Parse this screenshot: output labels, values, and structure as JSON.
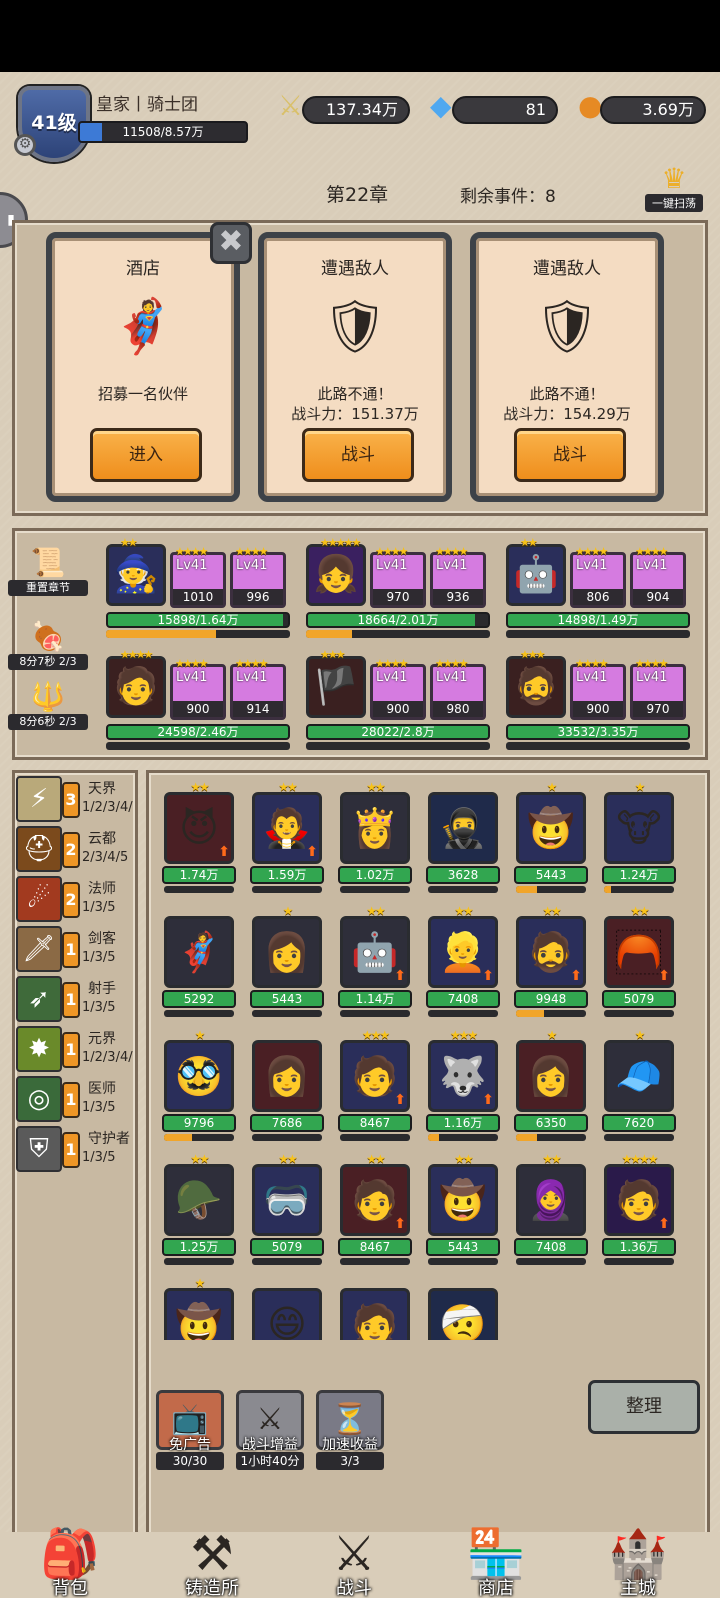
{
  "header": {
    "level": "41级",
    "player_name": "皇家丨骑士团",
    "exp_text": "11508/8.57万",
    "exp_fraction": 0.134,
    "combat_power": "137.34万",
    "gems": "81",
    "gold": "3.69万",
    "chapter": "第22章",
    "remaining_events": "剩余事件：8",
    "sweep_label": "一键扫荡"
  },
  "events": [
    {
      "title": "酒店",
      "icon": "hero-recruit-icon",
      "desc": "招募一名伙伴",
      "button": "进入"
    },
    {
      "title": "遭遇敌人",
      "icon": "armored-knight-icon",
      "desc": "此路不通！\n战斗力：151.37万",
      "button": "战斗"
    },
    {
      "title": "遭遇敌人",
      "icon": "armored-knight-icon",
      "desc": "此路不通！\n战斗力：154.29万",
      "button": "战斗"
    }
  ],
  "sidebar_tools": [
    {
      "label": "重置章节",
      "icon": "scroll-icon"
    },
    {
      "label": "8分7秒 2/3",
      "icon": "meat-icon"
    },
    {
      "label": "8分6秒 2/3",
      "icon": "staff-icon"
    }
  ],
  "team": [
    {
      "stars": 2,
      "equip": [
        {
          "lv": "Lv41",
          "count": "1010"
        },
        {
          "lv": "Lv41",
          "count": "996"
        }
      ],
      "hp": "15898/1.64万",
      "hp_fraction": 0.97,
      "sub_fraction": 0.6
    },
    {
      "stars": 5,
      "equip": [
        {
          "lv": "Lv41",
          "count": "970"
        },
        {
          "lv": "Lv41",
          "count": "936"
        }
      ],
      "hp": "18664/2.01万",
      "hp_fraction": 0.93,
      "sub_fraction": 0.25
    },
    {
      "stars": 2,
      "equip": [
        {
          "lv": "Lv41",
          "count": "806"
        },
        {
          "lv": "Lv41",
          "count": "904"
        }
      ],
      "hp": "14898/1.49万",
      "hp_fraction": 1.0,
      "sub_fraction": 0.0
    },
    {
      "stars": 4,
      "equip": [
        {
          "lv": "Lv41",
          "count": "900"
        },
        {
          "lv": "Lv41",
          "count": "914"
        }
      ],
      "hp": "24598/2.46万",
      "hp_fraction": 1.0,
      "sub_fraction": 0.0
    },
    {
      "stars": 3,
      "equip": [
        {
          "lv": "Lv41",
          "count": "900"
        },
        {
          "lv": "Lv41",
          "count": "980"
        }
      ],
      "hp": "28022/2.8万",
      "hp_fraction": 1.0,
      "sub_fraction": 0.0
    },
    {
      "stars": 3,
      "equip": [
        {
          "lv": "Lv41",
          "count": "900"
        },
        {
          "lv": "Lv41",
          "count": "970"
        }
      ],
      "hp": "33532/3.35万",
      "hp_fraction": 1.0,
      "sub_fraction": 0.0
    }
  ],
  "factions": [
    {
      "name": "天界",
      "count": "3",
      "progress": "1/2/3/4/",
      "icon": "lightning-icon",
      "color": "#b9a97a"
    },
    {
      "name": "云都",
      "count": "2",
      "progress": "2/3/4/5",
      "icon": "helmet-icon",
      "color": "#7b4a1c"
    },
    {
      "name": "法师",
      "count": "2",
      "progress": "1/3/5",
      "icon": "fireball-icon",
      "color": "#a23a1f"
    },
    {
      "name": "剑客",
      "count": "1",
      "progress": "1/3/5",
      "icon": "sword-icon",
      "color": "#8b6a45"
    },
    {
      "name": "射手",
      "count": "1",
      "progress": "1/3/5",
      "icon": "arrows-icon",
      "color": "#3f6a3a"
    },
    {
      "name": "元界",
      "count": "1",
      "progress": "1/2/3/4/",
      "icon": "burst-icon",
      "color": "#6a8a2a"
    },
    {
      "name": "医师",
      "count": "1",
      "progress": "1/3/5",
      "icon": "swirl-icon",
      "color": "#3a6a3a"
    },
    {
      "name": "守护者",
      "count": "1",
      "progress": "1/3/5",
      "icon": "shield-icon",
      "color": "#5a5a5a"
    }
  ],
  "roster": [
    {
      "stars": 2,
      "power": "1.74万",
      "power_fraction": 1.0,
      "sub_fraction": 0.0,
      "up": true,
      "bg": "#4a1f24"
    },
    {
      "stars": 2,
      "power": "1.59万",
      "power_fraction": 1.0,
      "sub_fraction": 0.0,
      "up": true,
      "bg": "#2a2e5a"
    },
    {
      "stars": 2,
      "power": "1.02万",
      "power_fraction": 1.0,
      "sub_fraction": 0.0,
      "up": false,
      "bg": "#2e2e3a"
    },
    {
      "stars": 0,
      "power": "3628",
      "power_fraction": 1.0,
      "sub_fraction": 0.0,
      "up": false,
      "bg": "#1f2a4a"
    },
    {
      "stars": 1,
      "power": "5443",
      "power_fraction": 1.0,
      "sub_fraction": 0.3,
      "up": false,
      "bg": "#2a2e5a"
    },
    {
      "stars": 1,
      "power": "1.24万",
      "power_fraction": 1.0,
      "sub_fraction": 0.1,
      "up": false,
      "bg": "#2a2e5a"
    },
    {
      "stars": 0,
      "power": "5292",
      "power_fraction": 1.0,
      "sub_fraction": 0.0,
      "up": false,
      "bg": "#2e2e3a"
    },
    {
      "stars": 1,
      "power": "5443",
      "power_fraction": 1.0,
      "sub_fraction": 0.0,
      "up": false,
      "bg": "#2e2e3a"
    },
    {
      "stars": 2,
      "power": "1.14万",
      "power_fraction": 1.0,
      "sub_fraction": 0.0,
      "up": true,
      "bg": "#2e2e3a"
    },
    {
      "stars": 2,
      "power": "7408",
      "power_fraction": 1.0,
      "sub_fraction": 0.0,
      "up": true,
      "bg": "#2a2e5a"
    },
    {
      "stars": 2,
      "power": "9948",
      "power_fraction": 1.0,
      "sub_fraction": 0.4,
      "up": true,
      "bg": "#2a2e5a"
    },
    {
      "stars": 2,
      "power": "5079",
      "power_fraction": 1.0,
      "sub_fraction": 0.0,
      "up": true,
      "bg": "#4a1f24"
    },
    {
      "stars": 1,
      "power": "9796",
      "power_fraction": 1.0,
      "sub_fraction": 0.4,
      "up": false,
      "bg": "#2a2e5a"
    },
    {
      "stars": 0,
      "power": "7686",
      "power_fraction": 1.0,
      "sub_fraction": 0.0,
      "up": false,
      "bg": "#4a1f24"
    },
    {
      "stars": 3,
      "power": "8467",
      "power_fraction": 1.0,
      "sub_fraction": 0.0,
      "up": true,
      "bg": "#2a2e5a"
    },
    {
      "stars": 3,
      "power": "1.16万",
      "power_fraction": 1.0,
      "sub_fraction": 0.15,
      "up": true,
      "bg": "#2a2e5a"
    },
    {
      "stars": 1,
      "power": "6350",
      "power_fraction": 1.0,
      "sub_fraction": 0.3,
      "up": false,
      "bg": "#4a1f24"
    },
    {
      "stars": 1,
      "power": "7620",
      "power_fraction": 1.0,
      "sub_fraction": 0.0,
      "up": false,
      "bg": "#2e2e3a"
    },
    {
      "stars": 2,
      "power": "1.25万",
      "power_fraction": 1.0,
      "sub_fraction": 0.0,
      "up": false,
      "bg": "#2e2e3a"
    },
    {
      "stars": 2,
      "power": "5079",
      "power_fraction": 1.0,
      "sub_fraction": 0.0,
      "up": false,
      "bg": "#2a2e5a"
    },
    {
      "stars": 2,
      "power": "8467",
      "power_fraction": 1.0,
      "sub_fraction": 0.0,
      "up": true,
      "bg": "#4a1f24"
    },
    {
      "stars": 2,
      "power": "5443",
      "power_fraction": 1.0,
      "sub_fraction": 0.0,
      "up": false,
      "bg": "#2a2e5a"
    },
    {
      "stars": 2,
      "power": "7408",
      "power_fraction": 1.0,
      "sub_fraction": 0.0,
      "up": false,
      "bg": "#2e2e3a"
    },
    {
      "stars": 4,
      "power": "1.36万",
      "power_fraction": 1.0,
      "sub_fraction": 0.0,
      "up": true,
      "bg": "#2a1a4a"
    },
    {
      "stars": 1,
      "power": "",
      "power_fraction": 0.0,
      "sub_fraction": 0.0,
      "up": false,
      "bg": "#2a2e5a"
    },
    {
      "stars": 0,
      "power": "",
      "power_fraction": 0.0,
      "sub_fraction": 0.0,
      "up": false,
      "bg": "#2a2e5a"
    },
    {
      "stars": 0,
      "power": "",
      "power_fraction": 0.0,
      "sub_fraction": 0.0,
      "up": false,
      "bg": "#2a2e5a"
    },
    {
      "stars": 0,
      "power": "",
      "power_fraction": 0.0,
      "sub_fraction": 0.0,
      "up": false,
      "bg": "#1f2a4a"
    }
  ],
  "boosts": [
    {
      "name": "免广告",
      "count": "30/30",
      "icon": "tv-icon"
    },
    {
      "name": "战斗增益",
      "count": "1小时40分",
      "icon": "sword-tv-icon"
    },
    {
      "name": "加速收益",
      "count": "3/3",
      "icon": "hourglass-icon"
    }
  ],
  "sort_label": "整理",
  "nav": [
    {
      "label": "背包",
      "icon": "backpack-icon"
    },
    {
      "label": "铸造所",
      "icon": "anvil-icon"
    },
    {
      "label": "战斗",
      "icon": "crossed-swords-icon"
    },
    {
      "label": "商店",
      "icon": "shop-icon"
    },
    {
      "label": "主城",
      "icon": "castle-icon"
    }
  ]
}
